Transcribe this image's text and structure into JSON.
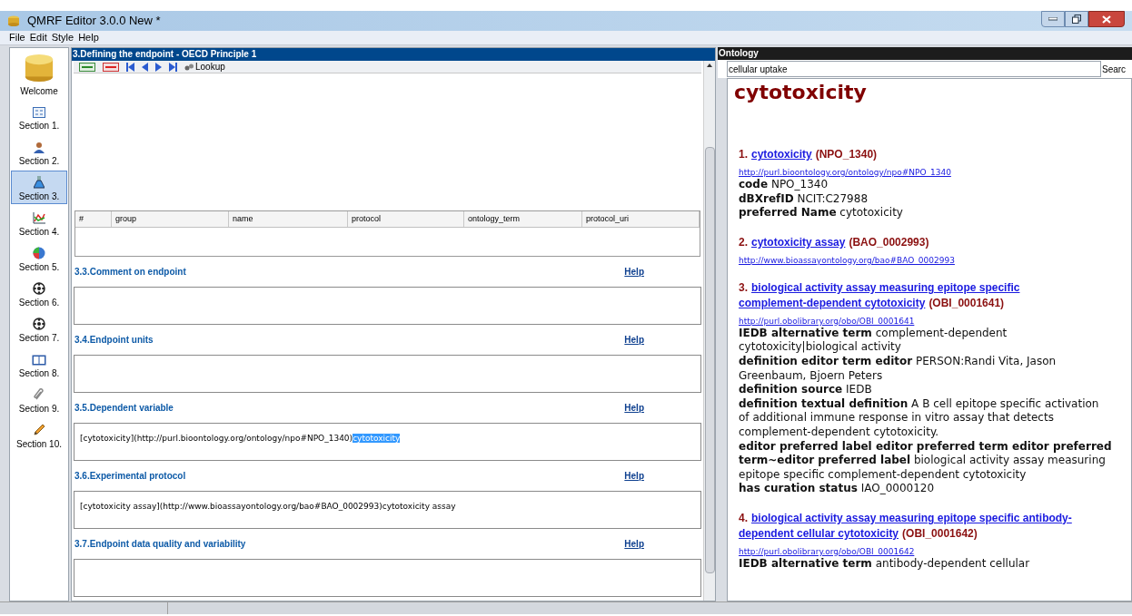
{
  "window": {
    "title": "QMRF Editor 3.0.0 New *"
  },
  "menu": [
    "File",
    "Edit",
    "Style",
    "Help"
  ],
  "sidebar": {
    "items": [
      {
        "label": "Welcome",
        "kind": "logo",
        "selected": false
      },
      {
        "label": "Section 1.",
        "kind": "form",
        "selected": false
      },
      {
        "label": "Section 2.",
        "kind": "person",
        "selected": false
      },
      {
        "label": "Section 3.",
        "kind": "flask",
        "selected": true
      },
      {
        "label": "Section 4.",
        "kind": "chart",
        "selected": false
      },
      {
        "label": "Section 5.",
        "kind": "pie",
        "selected": false
      },
      {
        "label": "Section 6.",
        "kind": "ball",
        "selected": false
      },
      {
        "label": "Section 7.",
        "kind": "ball",
        "selected": false
      },
      {
        "label": "Section 8.",
        "kind": "book",
        "selected": false
      },
      {
        "label": "Section 9.",
        "kind": "clip",
        "selected": false
      },
      {
        "label": "Section 10.",
        "kind": "pencil",
        "selected": false
      }
    ]
  },
  "main": {
    "title": "3.Defining the endpoint - OECD Principle 1",
    "toolbar": {
      "lookup": "Lookup"
    },
    "table": {
      "columns": [
        "#",
        "group",
        "name",
        "protocol",
        "ontology_term",
        "protocol_uri"
      ]
    },
    "fields": [
      {
        "label": "3.3.Comment on endpoint",
        "help": "Help"
      },
      {
        "label": "3.4.Endpoint units",
        "help": "Help"
      },
      {
        "label": "3.5.Dependent variable",
        "help": "Help",
        "value": "[cytotoxicity](http://purl.bioontology.org/ontology/npo#NPO_1340)",
        "selected_text": "cytotoxicity"
      },
      {
        "label": "3.6.Experimental protocol",
        "help": "Help",
        "value": "[cytotoxicity assay](http://www.bioassayontology.org/bao#BAO_0002993)cytotoxicity assay"
      },
      {
        "label": "3.7.Endpoint data quality and variability",
        "help": "Help"
      }
    ]
  },
  "ontology": {
    "title": "Ontology",
    "search": {
      "value": "cellular uptake",
      "button": "Searc"
    },
    "heading": "cytotoxicity",
    "entries": [
      {
        "number": "1.",
        "term": [
          "cytotoxicity"
        ],
        "id": "(NPO_1340)",
        "url": "http://purl.bioontology.org/ontology/npo#NPO_1340",
        "props": [
          {
            "key": "code",
            "value": "NPO_1340"
          },
          {
            "key": "dBXrefID",
            "value": "NCIT:C27988"
          },
          {
            "key": "preferred Name",
            "value": "cytotoxicity"
          }
        ]
      },
      {
        "number": "2.",
        "term": [
          "cytotoxicity assay"
        ],
        "id": "(BAO_0002993)",
        "url": "http://www.bioassayontology.org/bao#BAO_0002993"
      },
      {
        "number": "3.",
        "term": [
          "biological activity assay measuring epitope specific",
          "complement-dependent cytotoxicity"
        ],
        "id": "(OBI_0001641)",
        "url": "http://purl.obolibrary.org/obo/OBI_0001641",
        "props": [
          {
            "key": "IEDB alternative term",
            "value": "complement-dependent cytotoxicity|biological activity"
          },
          {
            "key": "definition editor term editor",
            "value": "PERSON:Randi Vita, Jason Greenbaum, Bjoern Peters"
          },
          {
            "key": "definition source",
            "value": "IEDB"
          },
          {
            "key": "definition textual definition",
            "value": "A B cell epitope specific activation of additional immune response in vitro assay that detects complement-dependent cytotoxicity."
          },
          {
            "key": "editor preferred label editor preferred term editor preferred term~editor preferred label",
            "value": "biological activity assay measuring epitope specific complement-dependent cytotoxicity"
          },
          {
            "key": "has curation status",
            "value": "IAO_0000120"
          }
        ]
      },
      {
        "number": "4.",
        "term": [
          "biological activity assay measuring epitope specific antibody-",
          "dependent cellular cytotoxicity"
        ],
        "id": "(OBI_0001642)",
        "url": "http://purl.obolibrary.org/obo/OBI_0001642",
        "props": [
          {
            "key": "IEDB alternative term",
            "value": "antibody-dependent cellular"
          }
        ]
      }
    ]
  }
}
